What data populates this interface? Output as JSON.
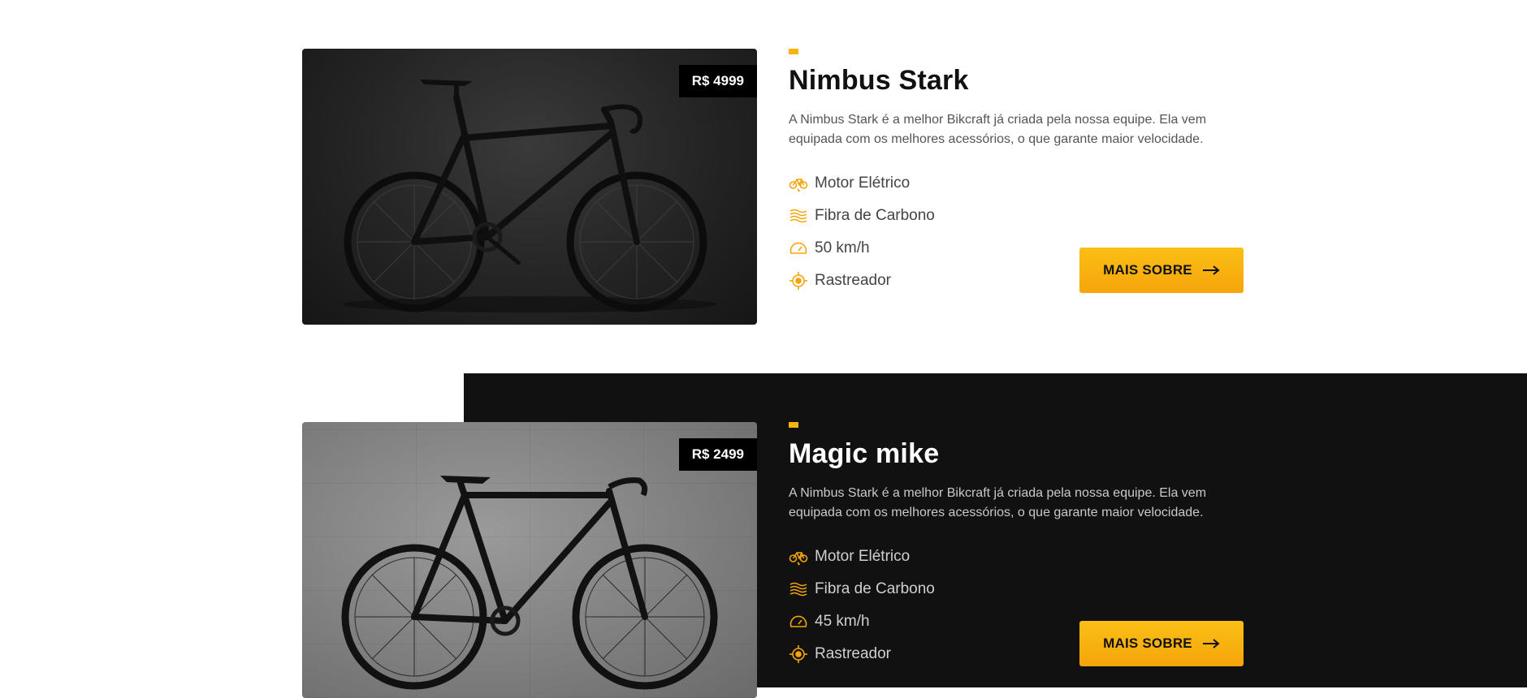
{
  "colors": {
    "accent": "#fbb40f",
    "dark_section": "#111111",
    "price_bg": "#000000"
  },
  "products": [
    {
      "price": "R$ 4999",
      "image_alt": "black road bike",
      "title": "Nimbus Stark",
      "description": "A Nimbus Stark é a melhor Bikcraft já criada pela nossa equipe. Ela vem equipada com os melhores acessórios, o que garante maior velocidade.",
      "features": [
        {
          "icon": "electric-motor-icon",
          "label": "Motor Elétrico"
        },
        {
          "icon": "carbon-fiber-icon",
          "label": "Fibra de Carbono"
        },
        {
          "icon": "speedometer-icon",
          "label": "50 km/h"
        },
        {
          "icon": "tracker-icon",
          "label": "Rastreador"
        }
      ],
      "button_label": "MAIS SOBRE"
    },
    {
      "price": "R$ 2499",
      "image_alt": "black fixed gear bike against concrete wall",
      "title": "Magic mike",
      "description": "A Nimbus Stark é a melhor Bikcraft já criada pela nossa equipe. Ela vem equipada com os melhores acessórios, o que garante maior velocidade.",
      "features": [
        {
          "icon": "electric-motor-icon",
          "label": "Motor Elétrico"
        },
        {
          "icon": "carbon-fiber-icon",
          "label": "Fibra de Carbono"
        },
        {
          "icon": "speedometer-icon",
          "label": "45 km/h"
        },
        {
          "icon": "tracker-icon",
          "label": "Rastreador"
        }
      ],
      "button_label": "MAIS SOBRE"
    }
  ]
}
